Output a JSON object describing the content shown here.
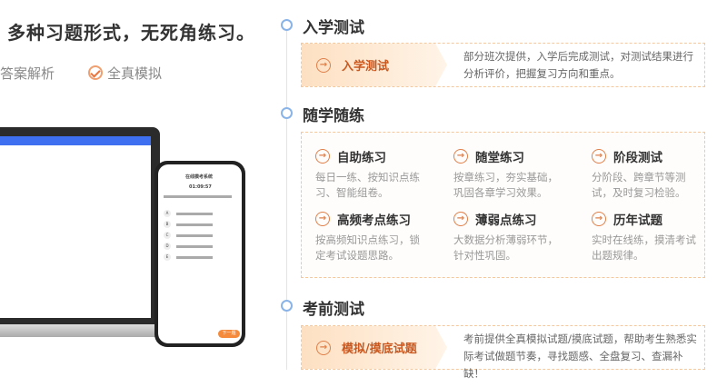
{
  "headline": "多种习题形式，无死角练习。",
  "features": [
    "答案解析",
    "全真模拟"
  ],
  "phone": {
    "title": "在线模考系统",
    "timer": "01:09:57",
    "options": [
      "A",
      "B",
      "C",
      "D",
      "E"
    ],
    "next": "下一题"
  },
  "sections": [
    {
      "heading": "入学测试",
      "tag": "入学测试",
      "desc": "部分班次提供，入学后完成测试，对测试结果进行分析评价，把握复习方向和重点。"
    },
    {
      "heading": "随学随练",
      "items": [
        {
          "title": "自助练习",
          "desc": "每日一练、按知识点练习、智能组卷。"
        },
        {
          "title": "随堂练习",
          "desc": "按章练习，夯实基础，巩固各章学习效果。"
        },
        {
          "title": "阶段测试",
          "desc": "分阶段、跨章节等测试，及时复习检验。"
        },
        {
          "title": "高频考点练习",
          "desc": "按高频知识点练习，锁定考试设题思路。"
        },
        {
          "title": "薄弱点练习",
          "desc": "大数据分析薄弱环节，针对性巩固。"
        },
        {
          "title": "历年试题",
          "desc": "实时在线练，摸清考试出题规律。"
        }
      ]
    },
    {
      "heading": "考前测试",
      "tag": "模拟/摸底试题",
      "desc": "考前提供全真模拟试题/摸底试题，帮助考生熟悉实际考试做题节奏，寻找题感、全盘复习、查漏补缺！"
    }
  ],
  "colors": {
    "accent": "#e0804a",
    "timeline": "#8ab4e8"
  }
}
